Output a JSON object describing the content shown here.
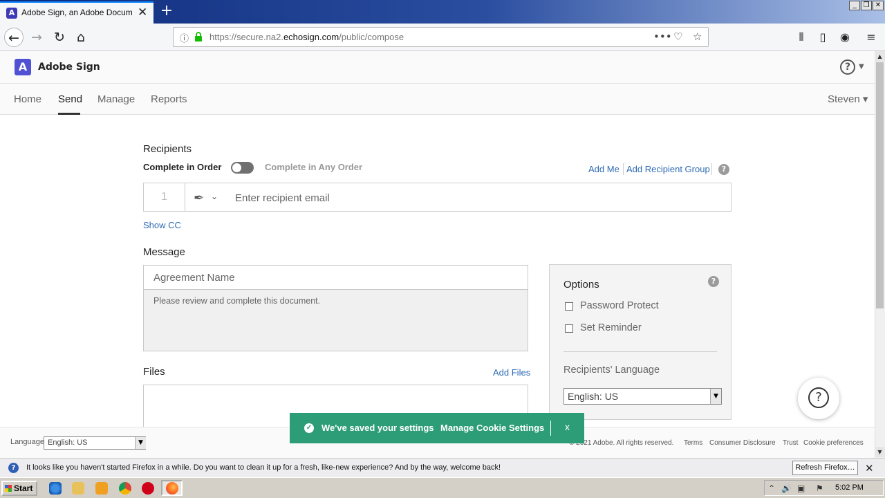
{
  "browser": {
    "tab_title": "Adobe Sign, an Adobe Document C",
    "tab_close": "✕",
    "new_tab": "+",
    "url_prefix": "https://secure.na2.",
    "url_domain": "echosign.com",
    "url_path": "/public/compose",
    "window_controls": [
      "_",
      "❐",
      "✕"
    ]
  },
  "app": {
    "brand": "Adobe Sign",
    "help": "?",
    "nav": [
      "Home",
      "Send",
      "Manage",
      "Reports"
    ],
    "active_nav": "Send",
    "user": "Steven ▾"
  },
  "recipients": {
    "heading": "Recipients",
    "complete_in_order": "Complete in Order",
    "complete_any_order": "Complete in Any Order",
    "add_me": "Add Me",
    "add_group": "Add Recipient Group",
    "row_number": "1",
    "email_placeholder": "Enter recipient email",
    "show_cc": "Show CC"
  },
  "message": {
    "heading": "Message",
    "agreement_placeholder": "Agreement Name",
    "body": "Please review and complete this document."
  },
  "files": {
    "heading": "Files",
    "add_files": "Add Files"
  },
  "options": {
    "heading": "Options",
    "items": [
      "Password Protect",
      "Set Reminder"
    ],
    "recipients_language_label": "Recipients' Language",
    "language_value": "English: US"
  },
  "footer": {
    "language_label": "Language",
    "language_value": "English: US",
    "copyright": "© 2021 Adobe. All rights reserved.",
    "links": [
      "Terms",
      "Consumer Disclosure",
      "Trust",
      "Cookie preferences"
    ]
  },
  "cookie_toast": {
    "message": "We've saved your settings",
    "manage": "Manage Cookie Settings",
    "close": "x"
  },
  "notification": {
    "text": "It looks like you haven't started Firefox in a while. Do you want to clean it up for a fresh, like-new experience? And by the way, welcome back!",
    "button": "Refresh Firefox…"
  },
  "taskbar": {
    "start": "Start",
    "clock": "5:02 PM"
  },
  "colors": {
    "accent_link": "#2d6bb5",
    "toast_green": "#2d9d78",
    "brand_purple": "#5151d3"
  }
}
